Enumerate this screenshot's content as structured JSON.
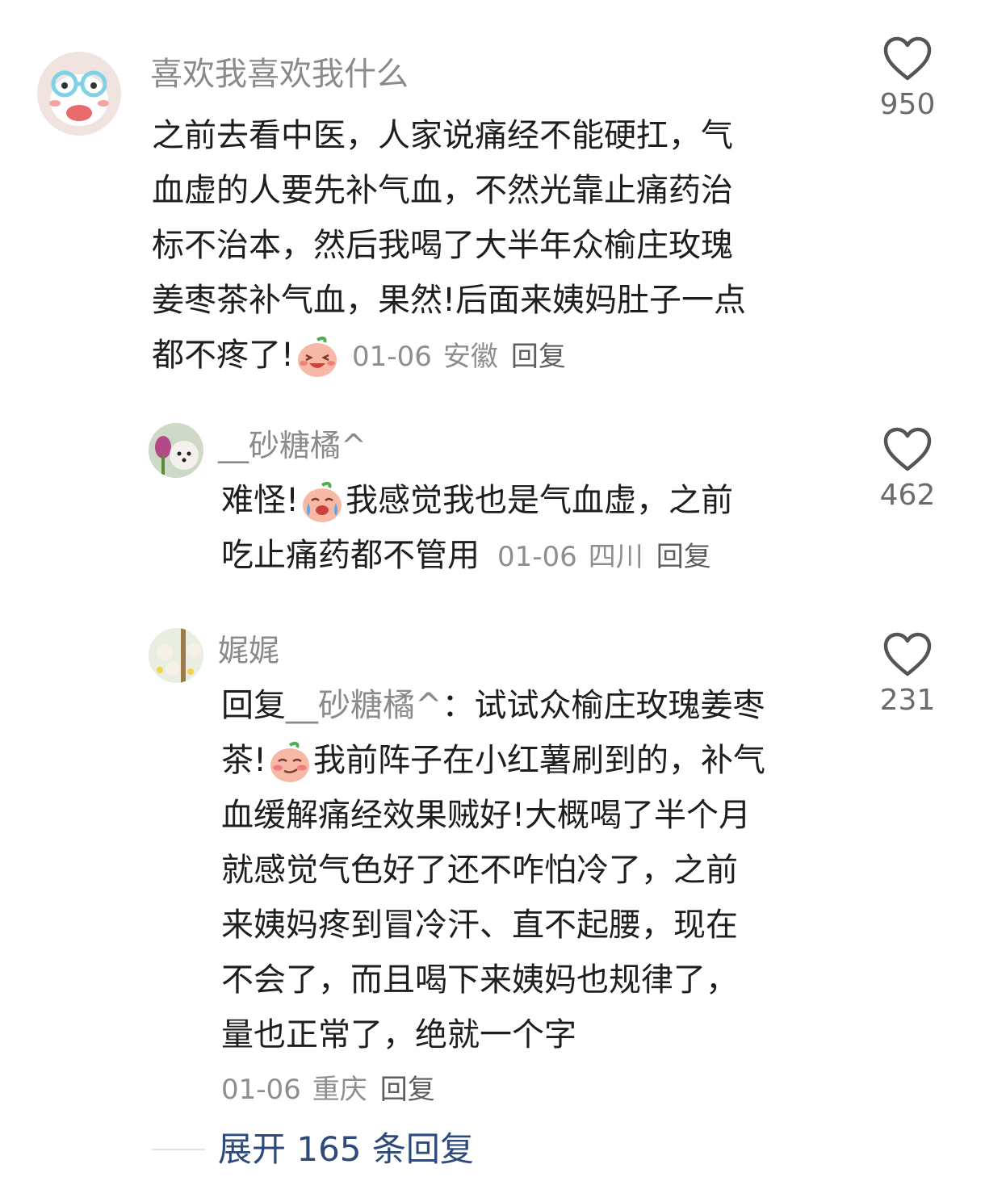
{
  "comments": [
    {
      "username": "喜欢我喜欢我什么",
      "text_lines": [
        "之前去看中医，人家说痛经不能硬扛，气",
        "血虚的人要先补气血，不然光靠止痛药治",
        "标不治本，然后我喝了大半年众榆庄玫瑰",
        "姜枣茶补气血，果然!后面来姨妈肚子一点",
        "都不疼了!"
      ],
      "emoji": "laughing-emoji",
      "date": "01-06",
      "location": "安徽",
      "reply_label": "回复",
      "likes": "950"
    },
    {
      "username": "__砂糖橘^",
      "text_line1_a": "难怪!",
      "text_line1_b": "我感觉我也是气血虚，之前",
      "text_line2": "吃止痛药都不管用",
      "emoji": "crying-laughing-emoji",
      "date": "01-06",
      "location": "四川",
      "reply_label": "回复",
      "likes": "462"
    },
    {
      "username": "娓娓",
      "reply_prefix": "回复",
      "reply_to": "__砂糖橘^",
      "reply_colon": "：试试众榆庄玫瑰姜枣",
      "line2_a": "茶!",
      "line2_b": "我前阵子在小红薯刷到的，补气",
      "text_lines": [
        "血缓解痛经效果贼好!大概喝了半个月",
        "就感觉气色好了还不咋怕冷了，之前",
        "来姨妈疼到冒冷汗、直不起腰，现在",
        "不会了，而且喝下来姨妈也规律了，",
        "量也正常了，绝就一个字"
      ],
      "emoji": "smirk-emoji",
      "date": "01-06",
      "location": "重庆",
      "reply_label": "回复",
      "likes": "231"
    }
  ],
  "expand_replies": "展开 165 条回复",
  "colors": {
    "username": "#8a8a8a",
    "body_text": "#1e1e1e",
    "meta": "#8e8e8e",
    "expand": "#2d4a7a",
    "emoji_face": "#f7b9a6"
  }
}
